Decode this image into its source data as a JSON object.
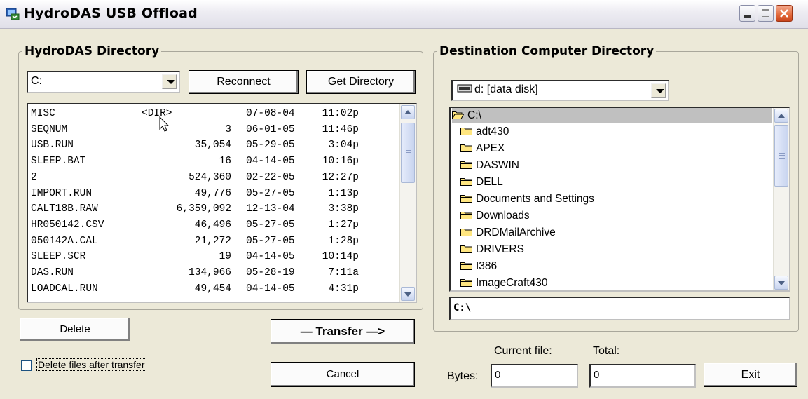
{
  "window": {
    "title": "HydroDAS USB Offload"
  },
  "source": {
    "legend": "HydroDAS Directory",
    "drive_value": "C:",
    "reconnect_label": "Reconnect",
    "get_directory_label": "Get Directory",
    "files": [
      {
        "name": "MISC",
        "size": "<DIR>",
        "date": "07-08-04",
        "time": "11:02p"
      },
      {
        "name": "SEQNUM",
        "size": "3",
        "date": "06-01-05",
        "time": "11:46p"
      },
      {
        "name": "USB.RUN",
        "size": "35,054",
        "date": "05-29-05",
        "time": "3:04p"
      },
      {
        "name": "SLEEP.BAT",
        "size": "16",
        "date": "04-14-05",
        "time": "10:16p"
      },
      {
        "name": "2",
        "size": "524,360",
        "date": "02-22-05",
        "time": "12:27p"
      },
      {
        "name": "IMPORT.RUN",
        "size": "49,776",
        "date": "05-27-05",
        "time": "1:13p"
      },
      {
        "name": "CALT18B.RAW",
        "size": "6,359,092",
        "date": "12-13-04",
        "time": "3:38p"
      },
      {
        "name": "HR050142.CSV",
        "size": "46,496",
        "date": "05-27-05",
        "time": "1:27p"
      },
      {
        "name": "050142A.CAL",
        "size": "21,272",
        "date": "05-27-05",
        "time": "1:28p"
      },
      {
        "name": "SLEEP.SCR",
        "size": "19",
        "date": "04-14-05",
        "time": "10:14p"
      },
      {
        "name": "DAS.RUN",
        "size": "134,966",
        "date": "05-28-19",
        "time": "7:11a"
      },
      {
        "name": "LOADCAL.RUN",
        "size": "49,454",
        "date": "04-14-05",
        "time": "4:31p"
      }
    ],
    "delete_label": "Delete",
    "delete_after_transfer_label": "Delete files after transfer",
    "delete_after_transfer_checked": false
  },
  "transfer_label": "— Transfer —>",
  "cancel_label": "Cancel",
  "destination": {
    "legend": "Destination Computer Directory",
    "drive_value": "d: [data disk]",
    "root": "C:\\",
    "folders": [
      "adt430",
      "APEX",
      "DASWIN",
      "DELL",
      "Documents and Settings",
      "Downloads",
      "DRDMailArchive",
      "DRIVERS",
      "I386",
      "ImageCraft430"
    ],
    "path": "C:\\"
  },
  "progress": {
    "current_file_label": "Current file:",
    "total_label": "Total:",
    "bytes_label": "Bytes:",
    "current_value": "0",
    "total_value": "0"
  },
  "exit_label": "Exit"
}
